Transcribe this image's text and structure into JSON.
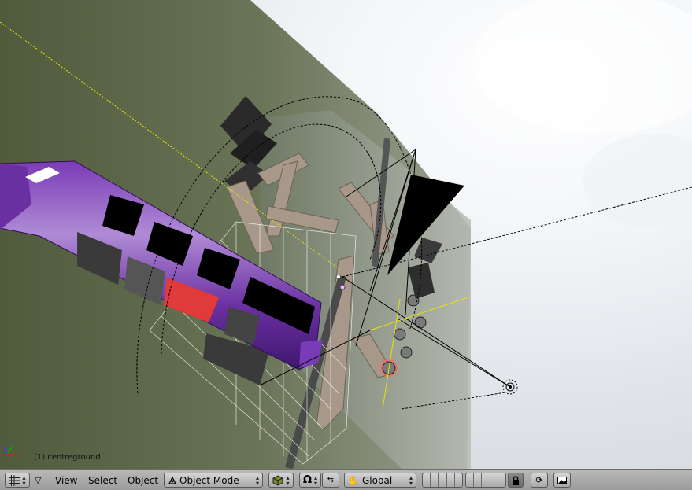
{
  "viewport": {
    "object_info": "(1) centreground"
  },
  "header": {
    "menus": {
      "view": "View",
      "select": "Select",
      "object": "Object"
    },
    "mode_select": "Object Mode",
    "orientation_select": "Global",
    "icons": {
      "window_type": "grid-icon",
      "draw_type": "solid-cube-icon",
      "pivot": "pivot-icon",
      "rotate_manipulator": "rotate-manipulator-icon",
      "transform_orientation_hand": "hand-icon",
      "layer_lock": "lock-icon",
      "render_preview": "render-icon",
      "image": "image-icon"
    },
    "colors": {
      "header_bg": "#a8a8a8",
      "button_bg": "#c4c4c4"
    }
  }
}
